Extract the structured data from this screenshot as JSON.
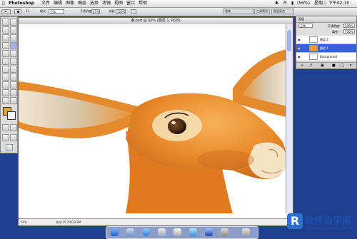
{
  "menubar": {
    "app": "Photoshop",
    "items": [
      "文件",
      "编辑",
      "图像",
      "图层",
      "选择",
      "滤镜",
      "视图",
      "窗口",
      "帮助"
    ],
    "battery": "(56%)",
    "clock": "星期二 下午02:10"
  },
  "options": {
    "mode_label": "模式:",
    "mode_value": "正常",
    "opacity_label": "不透明度:",
    "opacity_value": "67%",
    "flow_label": "流量:",
    "flow_value": "100%",
    "tabs": [
      "画笔",
      "工具预设",
      "图层复合"
    ]
  },
  "document": {
    "title": "鹿.psd @ 50% (图层 1, RGB)",
    "zoom": "50%",
    "docsize": "文档:15.7M/23.8M"
  },
  "layers_panel": {
    "tab_label": "图层",
    "blend_mode": "正常",
    "opacity_label": "不透明度:",
    "opacity_value": "100%",
    "fill_label": "填充:",
    "fill_value": "100%",
    "layers": [
      {
        "name": "图层 2",
        "selected": false
      },
      {
        "name": "图层 1",
        "selected": true
      },
      {
        "name": "Background",
        "selected": false
      }
    ]
  },
  "watermark": {
    "logo": "R",
    "line1": "软件自学网",
    "line2": "WWW.RJZXW.COM"
  },
  "colors": {
    "desktop": "#1f3f8f",
    "fur_orange": "#e8882a",
    "selection": "#3a5fd6"
  },
  "dock_icons": [
    "finder-icon",
    "mail-icon",
    "safari-icon",
    "itunes-icon",
    "iphoto-icon",
    "ichat-icon",
    "photoshop-icon",
    "settings-icon",
    "trash-icon"
  ]
}
